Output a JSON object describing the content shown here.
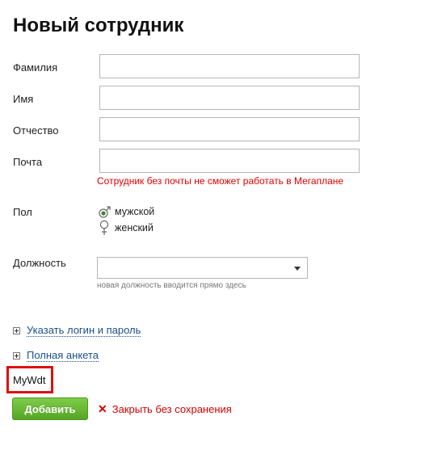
{
  "form": {
    "title": "Новый сотрудник",
    "fields": {
      "last_name": {
        "label": "Фамилия",
        "value": ""
      },
      "first_name": {
        "label": "Имя",
        "value": ""
      },
      "middle_name": {
        "label": "Отчество",
        "value": ""
      },
      "email": {
        "label": "Почта",
        "value": ""
      }
    },
    "email_warning": "Сотрудник без почты не сможет работать в Мегаплане",
    "gender": {
      "label": "Пол",
      "options": [
        {
          "label": "мужской",
          "selected": true,
          "icon": "male-icon"
        },
        {
          "label": "женский",
          "selected": false,
          "icon": "female-icon"
        }
      ]
    },
    "position": {
      "label": "Должность",
      "value": "",
      "hint": "новая должность вводится прямо здесь"
    },
    "expanders": {
      "login": "Указать логин и пароль",
      "full_profile": "Полная анкета"
    },
    "widget_label": "MyWdt",
    "actions": {
      "add": "Добавить",
      "close": "Закрыть без сохранения"
    }
  },
  "colors": {
    "warning": "#e00000",
    "link": "#1a4f8a",
    "button_green": "#5cb02c",
    "highlight_box": "#e01010",
    "close_red": "#d40000",
    "radio_selected": "#3a8a2a"
  }
}
